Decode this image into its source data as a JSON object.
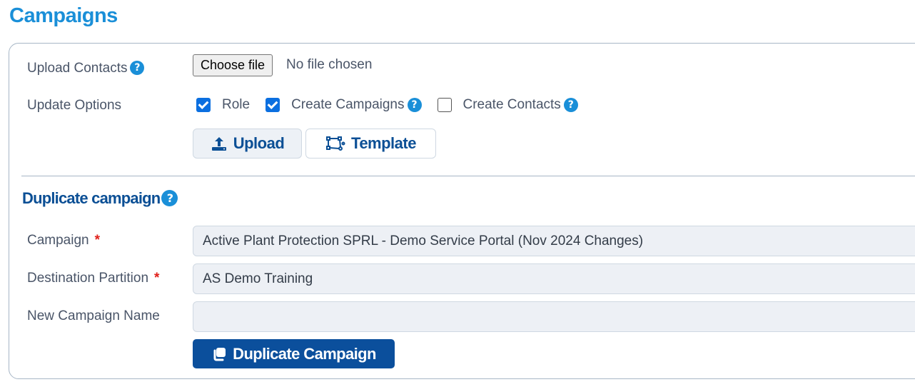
{
  "page": {
    "title": "Campaigns"
  },
  "upload": {
    "label": "Upload Contacts",
    "help": "?",
    "file_button": "Choose file",
    "file_status": "No file chosen"
  },
  "update_options": {
    "label": "Update Options",
    "options": [
      {
        "label": "Role",
        "checked": true,
        "help": false
      },
      {
        "label": "Create Campaigns",
        "checked": true,
        "help": true
      },
      {
        "label": "Create Contacts",
        "checked": false,
        "help": true
      }
    ],
    "help": "?"
  },
  "buttons": {
    "upload": "Upload",
    "template": "Template"
  },
  "duplicate": {
    "title": "Duplicate campaign",
    "help": "?",
    "required_mark": "*",
    "campaign_label": "Campaign",
    "campaign_value": "Active Plant Protection SPRL - Demo Service Portal (Nov 2024 Changes)",
    "partition_label": "Destination Partition",
    "partition_value": "AS Demo Training",
    "name_label": "New Campaign Name",
    "name_value": "",
    "button": "Duplicate Campaign"
  },
  "colors": {
    "title": "#1a8fd8",
    "primary": "#0b4f9c",
    "help": "#1a8fd8",
    "required": "#e0201a",
    "checkbox": "#0b6fe0"
  }
}
